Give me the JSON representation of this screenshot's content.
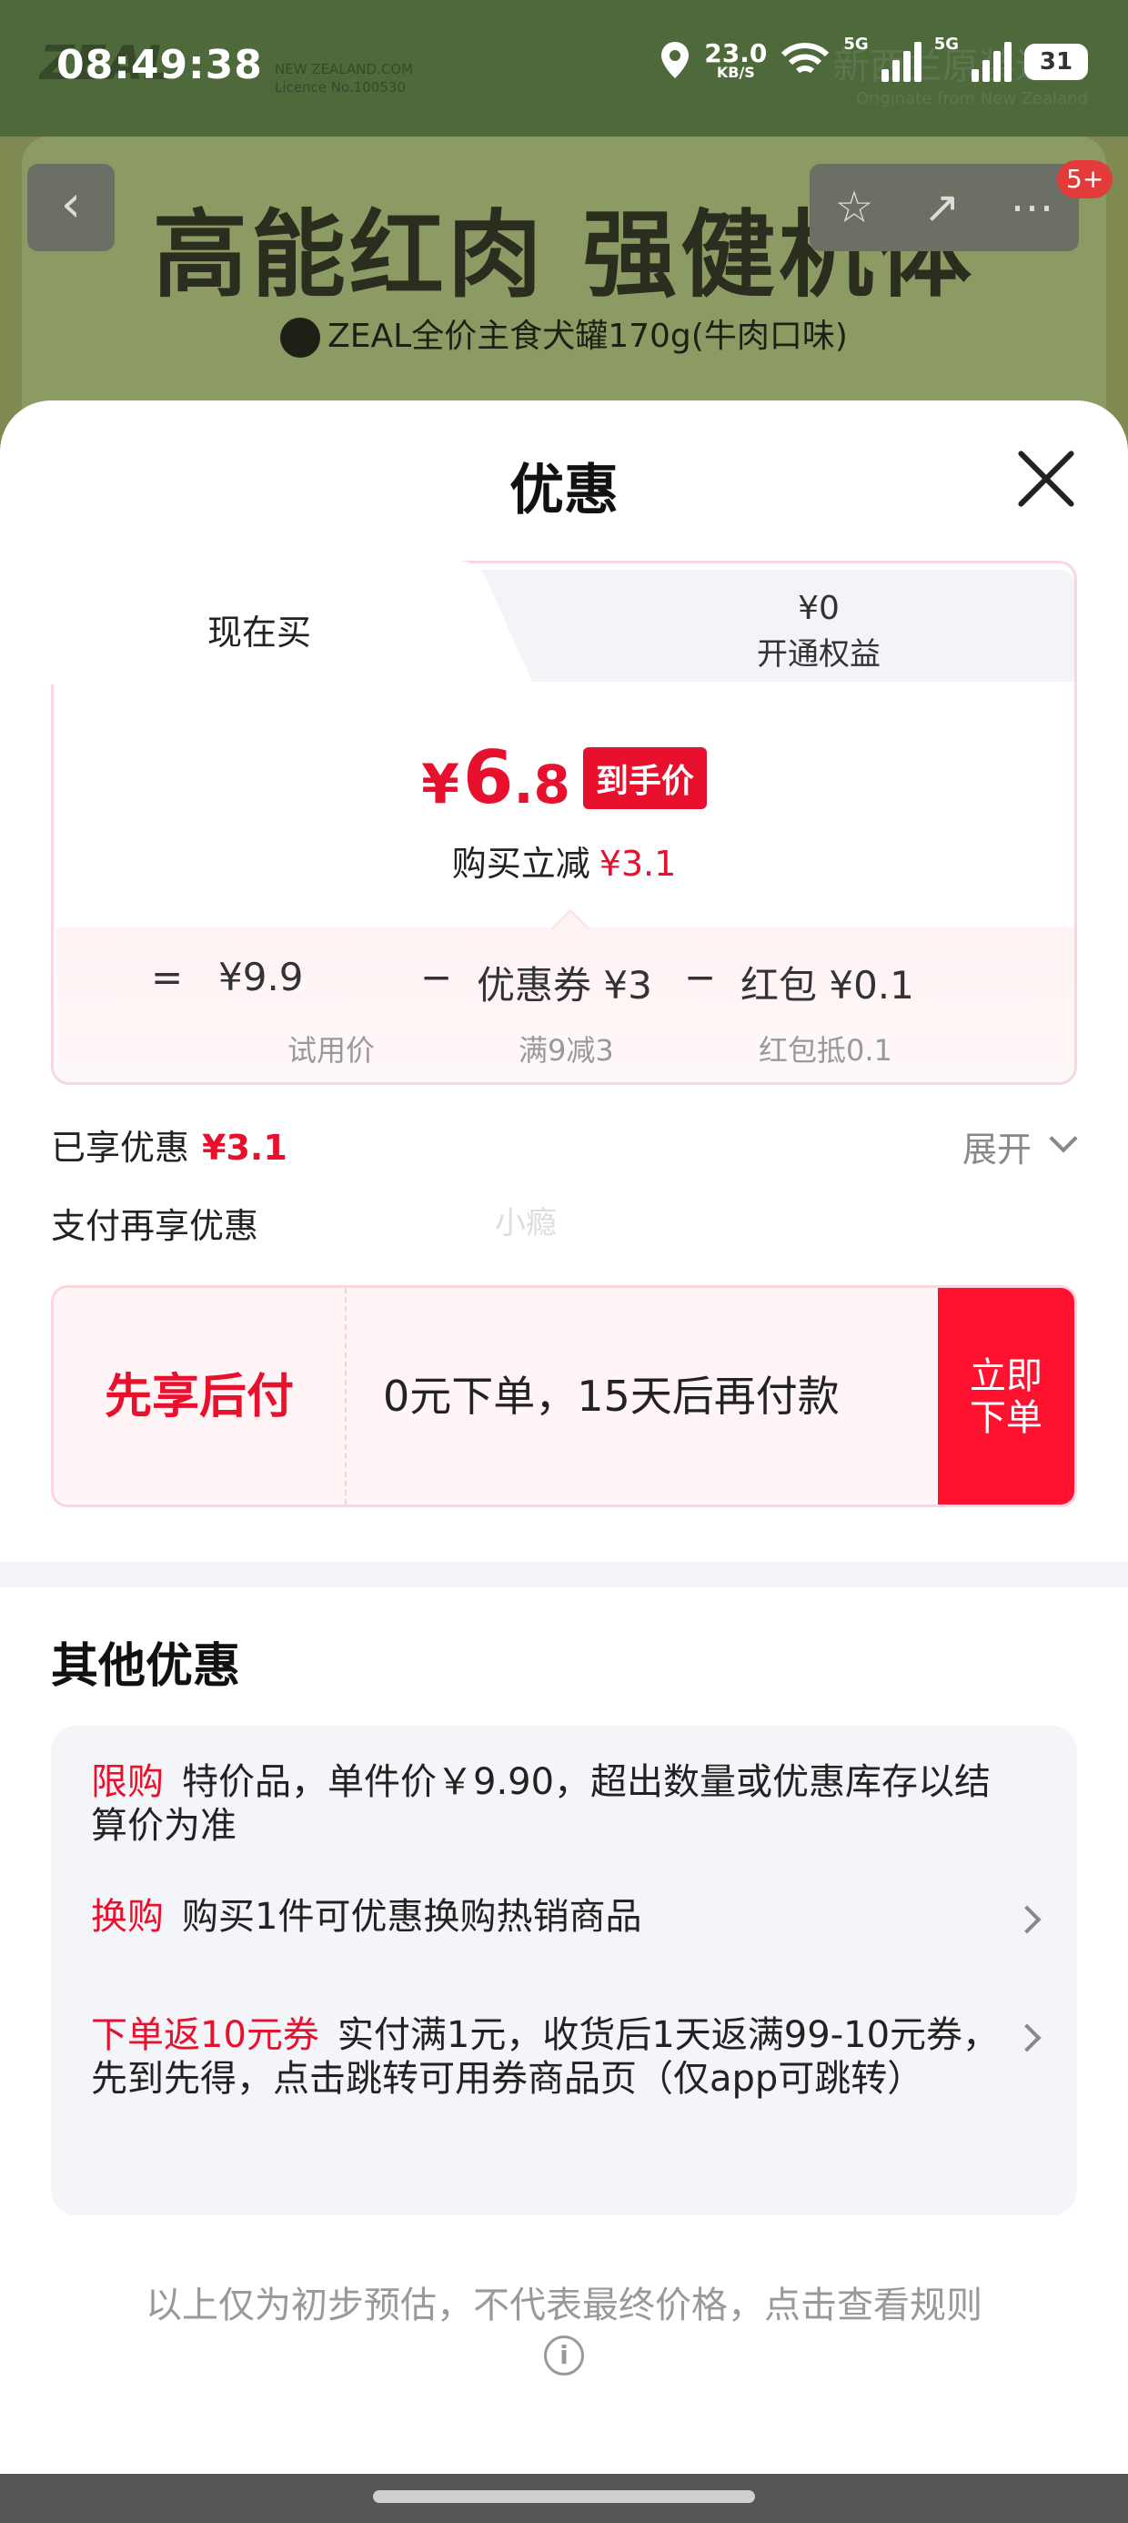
{
  "status_bar": {
    "time": "08:49:38",
    "net_speed": "23.0",
    "net_unit": "KB/S",
    "sig1": "5G",
    "sig2": "5G",
    "battery": "31"
  },
  "background": {
    "logo": "ZEAL",
    "logo_sub_1": "NEW ZEALAND.COM",
    "logo_sub_2": "Licence No.100530",
    "brand": "新西兰原装进口",
    "brand_sub": "Originate from New Zealand",
    "headline": "高能红肉 强健机体",
    "product": "ZEAL全价主食犬罐170g(牛肉口味)",
    "badge": "5+"
  },
  "sheet": {
    "title": "优惠",
    "tabs": {
      "buy_now": "现在买",
      "benefit_amount": "¥0",
      "benefit_label": "开通权益"
    },
    "price": {
      "currency": "¥",
      "integer": "6",
      "decimal": ".8",
      "tag": "到手价",
      "save_label": "购买立减",
      "save_amount": "¥3.1"
    },
    "calc": {
      "equals": "=",
      "trial_price": "¥9.9",
      "trial_label": "试用价",
      "minus": "−",
      "coupon": "优惠券 ¥3",
      "coupon_label": "满9减3",
      "redpack": "红包 ¥0.1",
      "redpack_label": "红包抵0.1"
    },
    "enjoyed_label": "已享优惠",
    "enjoyed_amount": "¥3.1",
    "expand": "展开",
    "pay_more": "支付再享优惠",
    "watermark": "小瘾",
    "bnpl": {
      "title": "先享后付",
      "desc": "0元下单，15天后再付款",
      "button_line1": "立即",
      "button_line2": "下单"
    },
    "other_title": "其他优惠",
    "promos": [
      {
        "tag": "限购",
        "text": "特价品，单件价￥9.90，超出数量或优惠库存以结算价为准"
      },
      {
        "tag": "换购",
        "text": "购买1件可优惠换购热销商品"
      },
      {
        "tag": "下单返10元券",
        "text": "实付满1元，收货后1天返满99-10元券，先到先得，点击跳转可用券商品页（仅app可跳转）"
      }
    ],
    "disclaimer": "以上仅为初步预估，不代表最终价格，点击查看规则"
  }
}
